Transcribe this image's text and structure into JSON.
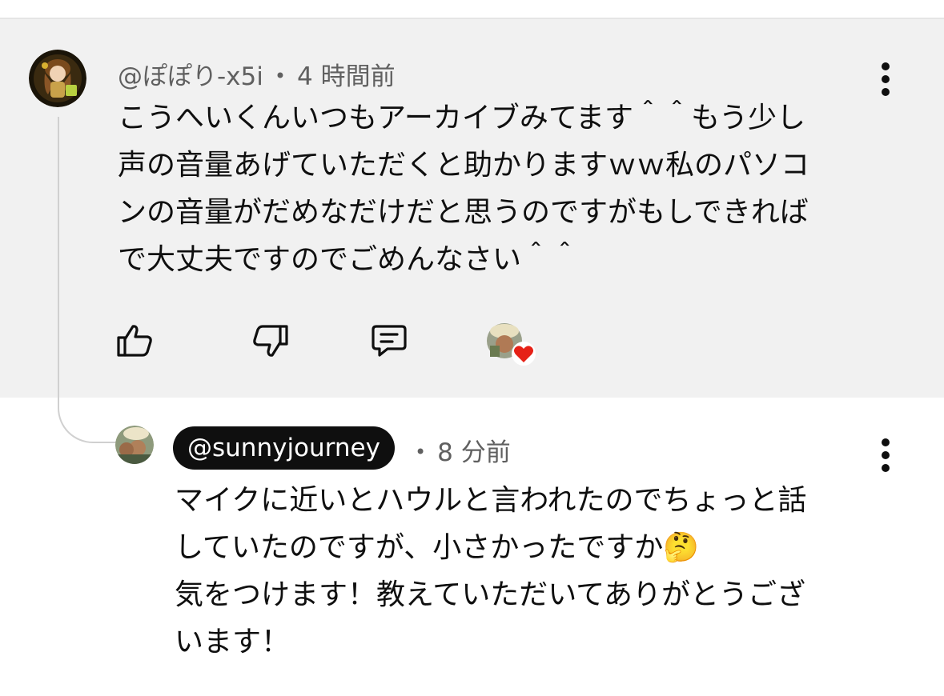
{
  "comment": {
    "author": "@ぽぽり-x5i",
    "separator": "•",
    "time": "4 時間前",
    "lines": [
      "こうへいくんいつもアーカイブみてます＾＾もう少し",
      "声の音量あげていただくと助かりますｗｗ私のパソコ",
      "ンの音量がだめなだけだと思うのですがもしできれば",
      "で大丈夫ですのでごめんなさい＾＾"
    ],
    "icons": {
      "like": "thumbs-up-icon",
      "dislike": "thumbs-down-icon",
      "reply": "reply-comment-icon",
      "more": "more-vert-icon",
      "creator_heart": "creator-heart-icon"
    },
    "heart_color": "#e62117"
  },
  "reply": {
    "author": "@sunnyjourney",
    "separator": "•",
    "time": "8 分前",
    "lines": [
      "マイクに近いとハウルと言われたのでちょっと話",
      "していたのですが、小さかったですか🤔",
      "気をつけます！教えていただいてありがとうござ",
      "います！"
    ]
  }
}
